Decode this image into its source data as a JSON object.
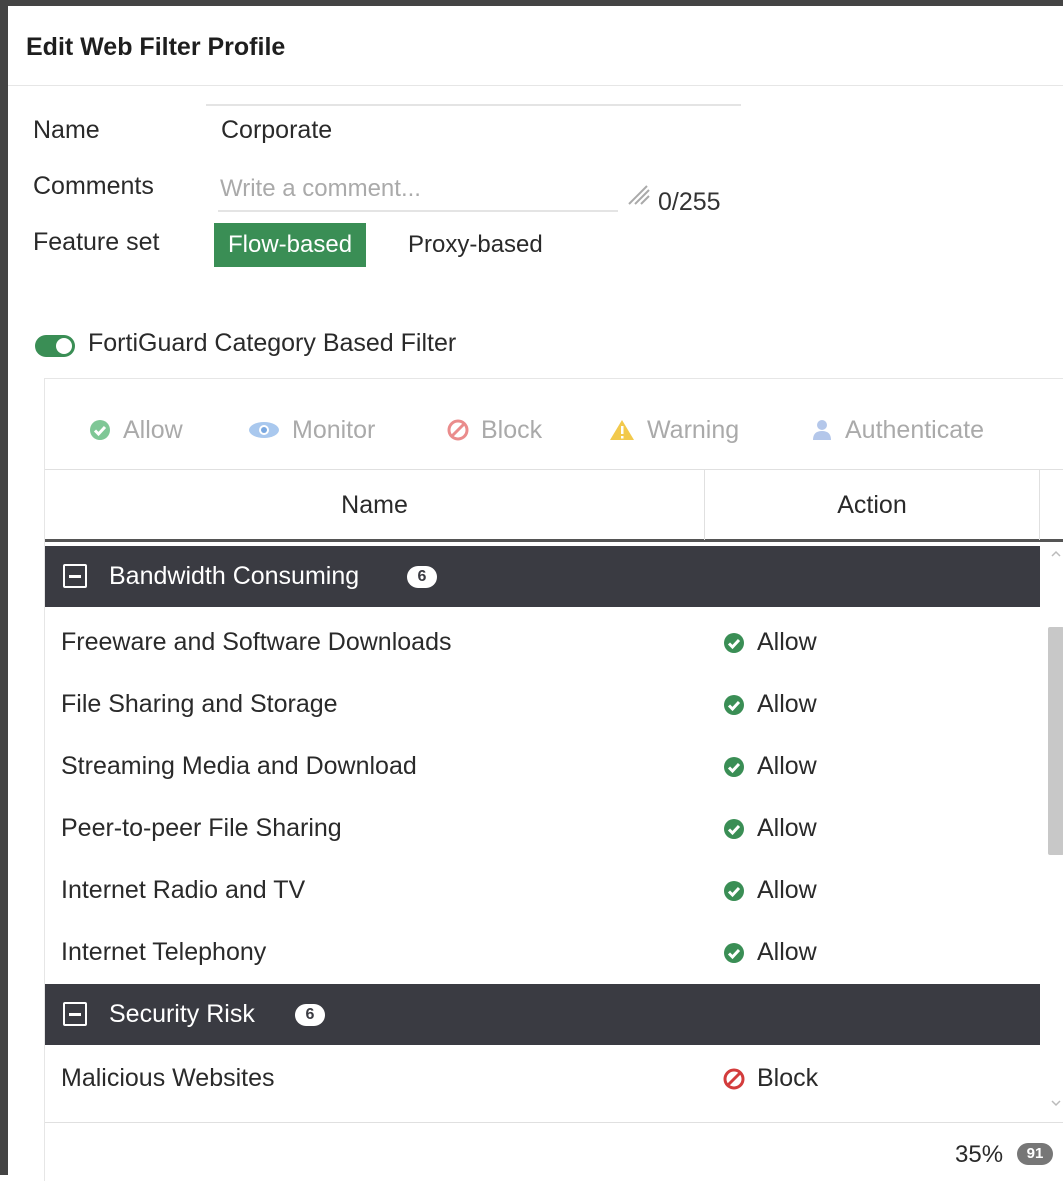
{
  "window": {
    "title": "Edit Web Filter Profile"
  },
  "form": {
    "name_label": "Name",
    "name_value": "Corporate",
    "comments_label": "Comments",
    "comments_placeholder": "Write a comment...",
    "comments_value": "",
    "char_count": "0/255",
    "feature_set_label": "Feature set",
    "feature_set_options": [
      "Flow-based",
      "Proxy-based"
    ],
    "feature_set_selected": "Flow-based"
  },
  "fortiguard": {
    "label": "FortiGuard Category Based Filter",
    "enabled": true
  },
  "action_bar": [
    {
      "label": "Allow",
      "icon": "check-circle-icon",
      "color": "#3a8e55"
    },
    {
      "label": "Monitor",
      "icon": "eye-icon",
      "color": "#4a90d9"
    },
    {
      "label": "Block",
      "icon": "block-icon",
      "color": "#d33c3c"
    },
    {
      "label": "Warning",
      "icon": "warning-icon",
      "color": "#e8a800"
    },
    {
      "label": "Authenticate",
      "icon": "user-icon",
      "color": "#6a8fd0"
    }
  ],
  "table": {
    "columns": [
      "Name",
      "Action"
    ],
    "groups": [
      {
        "name": "Bandwidth Consuming",
        "count": "6",
        "rows": [
          {
            "name": "Freeware and Software Downloads",
            "action": "Allow"
          },
          {
            "name": "File Sharing and Storage",
            "action": "Allow"
          },
          {
            "name": "Streaming Media and Download",
            "action": "Allow"
          },
          {
            "name": "Peer-to-peer File Sharing",
            "action": "Allow"
          },
          {
            "name": "Internet Radio and TV",
            "action": "Allow"
          },
          {
            "name": "Internet Telephony",
            "action": "Allow"
          }
        ]
      },
      {
        "name": "Security Risk",
        "count": "6",
        "rows": [
          {
            "name": "Malicious Websites",
            "action": "Block"
          }
        ]
      }
    ],
    "footer": {
      "percent": "35%",
      "total": "91"
    }
  },
  "colors": {
    "accent_green": "#3a8e55",
    "group_header": "#3a3b42",
    "block_red": "#d33c3c"
  }
}
